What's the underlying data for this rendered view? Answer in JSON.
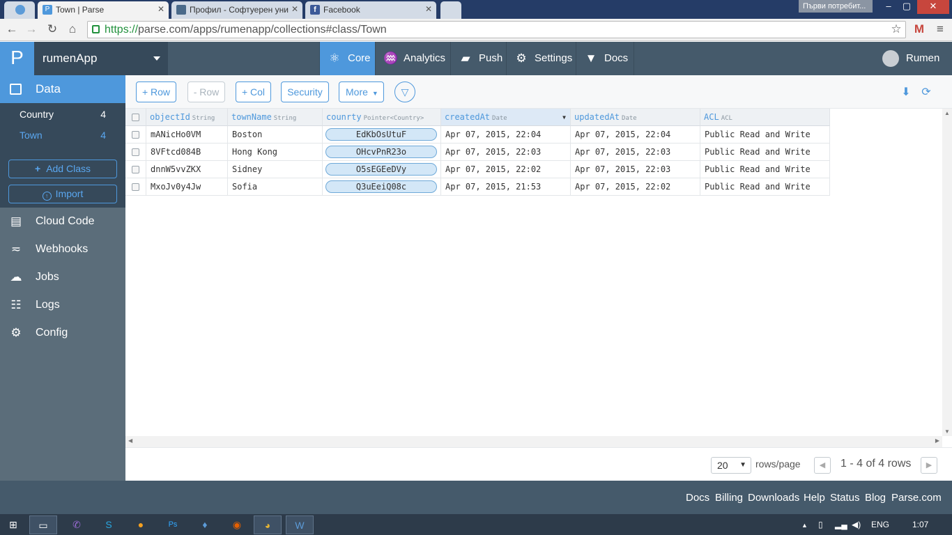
{
  "browser": {
    "tabs": [
      {
        "title": "",
        "icon": "globe-icon"
      },
      {
        "title": "Town | Parse",
        "icon": "parse-icon"
      },
      {
        "title": "Профил - Софтуерен уни",
        "icon": "softuni-icon"
      },
      {
        "title": "Facebook",
        "icon": "facebook-icon"
      },
      {
        "title": "",
        "icon": "new-tab-icon"
      }
    ],
    "user_tag": "Първи потребит...",
    "url_protocol": "https://",
    "url_rest": "parse.com/apps/rumenapp/collections#class/Town"
  },
  "header": {
    "logo": "P",
    "app_name": "rumenApp",
    "nav": [
      {
        "label": "Core",
        "icon": "atom-icon"
      },
      {
        "label": "Analytics",
        "icon": "pulse-icon"
      },
      {
        "label": "Push",
        "icon": "speech-icon"
      },
      {
        "label": "Settings",
        "icon": "gear-icon"
      },
      {
        "label": "Docs",
        "icon": "mortarboard-icon"
      }
    ],
    "user": "Rumen"
  },
  "sidebar": {
    "data_label": "Data",
    "classes": [
      {
        "name": "Country",
        "count": "4"
      },
      {
        "name": "Town",
        "count": "4"
      }
    ],
    "add_class": "Add Class",
    "import": "Import",
    "menu": [
      {
        "label": "Cloud Code",
        "icon": "document-icon"
      },
      {
        "label": "Webhooks",
        "icon": "webhook-icon"
      },
      {
        "label": "Jobs",
        "icon": "cloud-icon"
      },
      {
        "label": "Logs",
        "icon": "cabinet-icon"
      },
      {
        "label": "Config",
        "icon": "gears-icon"
      }
    ]
  },
  "toolbar": {
    "add_row": "+ Row",
    "remove_row": "- Row",
    "add_col": "+ Col",
    "security": "Security",
    "more": "More"
  },
  "table": {
    "columns": [
      {
        "name": "objectId",
        "type": "String"
      },
      {
        "name": "townName",
        "type": "String"
      },
      {
        "name": "counrty",
        "type": "Pointer<Country>"
      },
      {
        "name": "createdAt",
        "type": "Date"
      },
      {
        "name": "updatedAt",
        "type": "Date"
      },
      {
        "name": "ACL",
        "type": "ACL"
      }
    ],
    "rows": [
      [
        "mANicHo0VM",
        "Boston",
        "EdKbOsUtuF",
        "Apr 07, 2015, 22:04",
        "Apr 07, 2015, 22:04",
        "Public Read and Write"
      ],
      [
        "8VFtcd084B",
        "Hong Kong",
        "OHcvPnR23o",
        "Apr 07, 2015, 22:03",
        "Apr 07, 2015, 22:03",
        "Public Read and Write"
      ],
      [
        "dnnW5vvZKX",
        "Sidney",
        "O5sEGEeDVy",
        "Apr 07, 2015, 22:02",
        "Apr 07, 2015, 22:03",
        "Public Read and Write"
      ],
      [
        "MxoJv0y4Jw",
        "Sofia",
        "Q3uEeiQ08c",
        "Apr 07, 2015, 21:53",
        "Apr 07, 2015, 22:02",
        "Public Read and Write"
      ]
    ]
  },
  "pager": {
    "rows_per_page": "20",
    "rows_label": "rows/page",
    "range": "1 - 4 of 4 rows"
  },
  "footer": {
    "links": [
      "Docs",
      "Billing",
      "Downloads",
      "Help",
      "Status",
      "Blog",
      "Parse.com"
    ]
  },
  "taskbar": {
    "lang": "ENG",
    "time": "1:07"
  }
}
